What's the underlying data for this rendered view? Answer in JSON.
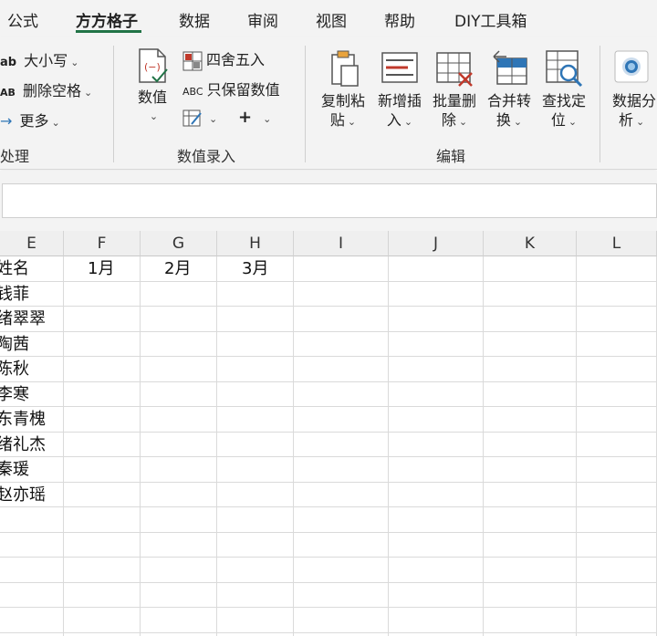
{
  "tabs": [
    "公式",
    "方方格子",
    "数据",
    "审阅",
    "视图",
    "帮助",
    "DIY工具箱"
  ],
  "ribbon": {
    "text_group": {
      "case_btn": "大小写",
      "case_prefix": "ab",
      "delete_space_btn": "删除空格",
      "delete_space_prefix": "AB",
      "more_btn": "更多",
      "label": "处理"
    },
    "numeric_group": {
      "value_btn_line1": "数值",
      "round_btn": "四舍五入",
      "keep_values_btn": "只保留数值",
      "keep_values_prefix": "ABC",
      "plus_btn": "+",
      "label": "数值录入"
    },
    "edit_group": {
      "copy_paste": [
        "复制粘",
        "贴"
      ],
      "insert": [
        "新增插",
        "入"
      ],
      "batch_delete": [
        "批量删",
        "除"
      ],
      "merge_convert": [
        "合并转",
        "换"
      ],
      "find_locate": [
        "查找定",
        "位"
      ],
      "label": "编辑"
    },
    "analysis_group": {
      "data_analysis": [
        "数据分",
        "析"
      ]
    }
  },
  "formula_bar": {
    "value": ""
  },
  "columns": [
    "E",
    "F",
    "G",
    "H",
    "I",
    "J",
    "K",
    "L"
  ],
  "rows": [
    [
      "姓名",
      "1月",
      "2月",
      "3月"
    ],
    [
      "钱菲"
    ],
    [
      "绪翠翠"
    ],
    [
      "陶茜"
    ],
    [
      "陈秋"
    ],
    [
      "李寒"
    ],
    [
      "东青槐"
    ],
    [
      "绪礼杰"
    ],
    [
      "秦瑗"
    ],
    [
      "赵亦瑶"
    ]
  ],
  "colors": {
    "accent": "#217346",
    "icon_red": "#c0392b",
    "icon_blue": "#2e75b6"
  }
}
